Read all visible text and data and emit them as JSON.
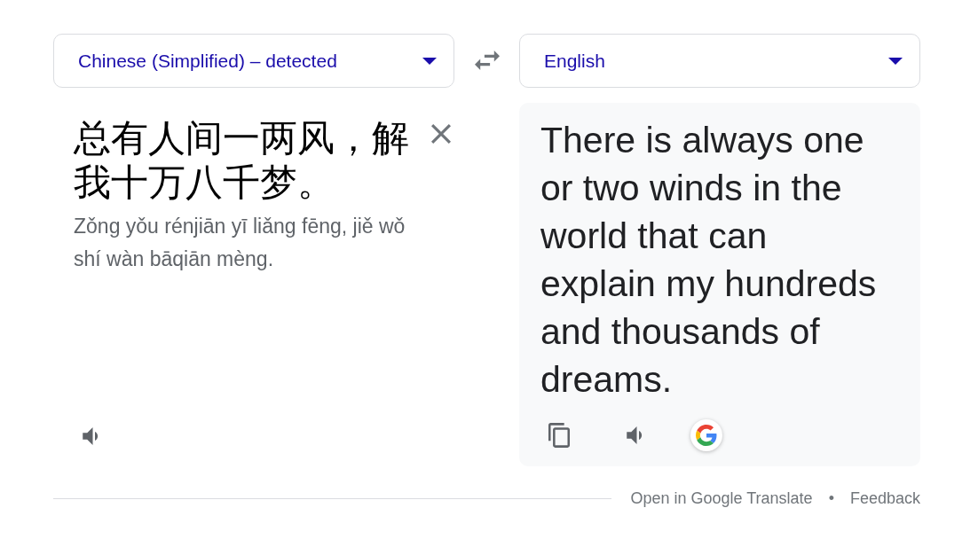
{
  "source_language": {
    "label": "Chinese (Simplified) – detected"
  },
  "target_language": {
    "label": "English"
  },
  "source": {
    "text": "总有人间一两风，解我十万八千梦。",
    "romanization": "Zǒng yǒu rénjiān yī liǎng fēng, jiě wǒ shí wàn bāqiān mèng."
  },
  "translation": {
    "text": "There is always one or two winds in the world that can explain my hundreds and thousands of dreams."
  },
  "footer": {
    "links": [
      "Open in Google Translate",
      "Feedback"
    ],
    "separator": "•"
  }
}
